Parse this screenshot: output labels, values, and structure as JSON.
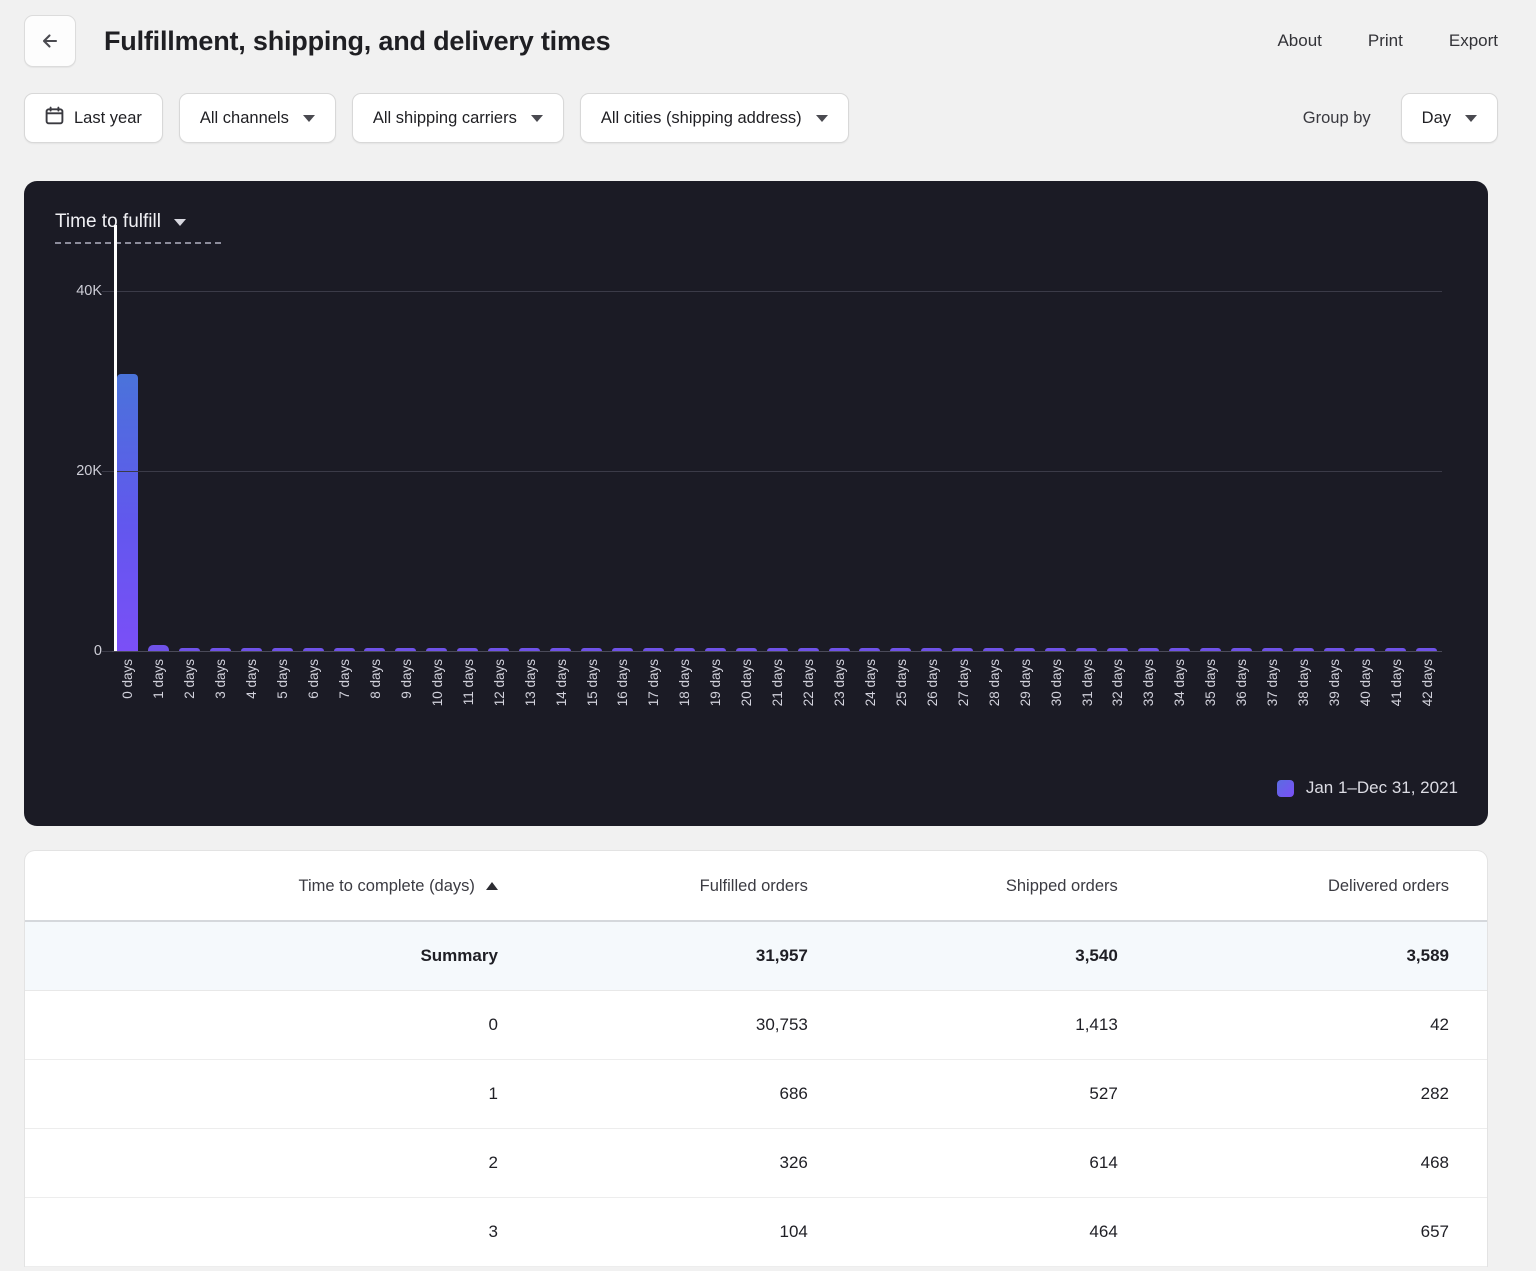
{
  "header": {
    "back_icon": "arrow-left-icon",
    "title": "Fulfillment, shipping, and delivery times",
    "actions": [
      {
        "label": "About"
      },
      {
        "label": "Print"
      },
      {
        "label": "Export"
      }
    ]
  },
  "filters": {
    "date_icon": "calendar-icon",
    "date_range": "Last year",
    "channels": "All channels",
    "carriers": "All shipping carriers",
    "cities": "All cities (shipping address)",
    "group_by_label": "Group by",
    "group_by_value": "Day"
  },
  "chart_panel": {
    "metric_label": "Time to fulfill",
    "metric_caret_icon": "chevron-down-icon",
    "legend_label": "Jan 1–Dec 31, 2021",
    "legend_color": "#6a5bec",
    "background": "#1b1b25"
  },
  "chart_data": {
    "type": "bar",
    "title": "Time to fulfill",
    "xlabel": "",
    "ylabel": "",
    "ylim": [
      0,
      40000
    ],
    "yticks": [
      0,
      20000,
      40000
    ],
    "ytick_labels": [
      "0",
      "20K",
      "40K"
    ],
    "grid": true,
    "legend_position": "bottom-right",
    "series_name": "Jan 1–Dec 31, 2021",
    "bar_color_top": "#4a73da",
    "bar_color_bottom": "#7b4ff7",
    "crosshair_at_category": "0 days",
    "categories": [
      "0 days",
      "1 days",
      "2 days",
      "3 days",
      "4 days",
      "5 days",
      "6 days",
      "7 days",
      "8 days",
      "9 days",
      "10 days",
      "11 days",
      "12 days",
      "13 days",
      "14 days",
      "15 days",
      "16 days",
      "17 days",
      "18 days",
      "19 days",
      "20 days",
      "21 days",
      "22 days",
      "23 days",
      "24 days",
      "25 days",
      "26 days",
      "27 days",
      "28 days",
      "29 days",
      "30 days",
      "31 days",
      "32 days",
      "33 days",
      "34 days",
      "35 days",
      "36 days",
      "37 days",
      "38 days",
      "39 days",
      "40 days",
      "41 days",
      "42 days"
    ],
    "values": [
      30753,
      686,
      326,
      104,
      95,
      90,
      88,
      86,
      85,
      84,
      83,
      82,
      82,
      81,
      80,
      80,
      79,
      79,
      78,
      78,
      77,
      77,
      76,
      76,
      75,
      75,
      74,
      74,
      73,
      73,
      72,
      72,
      71,
      71,
      70,
      70,
      69,
      69,
      68,
      68,
      67,
      67,
      66
    ]
  },
  "table": {
    "columns": [
      "Time to complete (days)",
      "Fulfilled orders",
      "Shipped orders",
      "Delivered orders"
    ],
    "sort_column": "Time to complete (days)",
    "sort_icon": "sort-ascending-icon",
    "summary": {
      "label": "Summary",
      "fulfilled": "31,957",
      "shipped": "3,540",
      "delivered": "3,589"
    },
    "rows": [
      {
        "days": "0",
        "fulfilled": "30,753",
        "shipped": "1,413",
        "delivered": "42"
      },
      {
        "days": "1",
        "fulfilled": "686",
        "shipped": "527",
        "delivered": "282"
      },
      {
        "days": "2",
        "fulfilled": "326",
        "shipped": "614",
        "delivered": "468"
      },
      {
        "days": "3",
        "fulfilled": "104",
        "shipped": "464",
        "delivered": "657"
      }
    ]
  }
}
